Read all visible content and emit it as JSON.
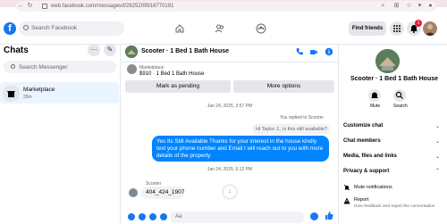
{
  "browser": {
    "url": "web.facebook.com/messages/t/28252099167701​91"
  },
  "header": {
    "logo_letter": "f",
    "search_placeholder": "Search Facebook",
    "find_friends_label": "Find friends",
    "notification_count": "1"
  },
  "left": {
    "title": "Chats",
    "search_placeholder": "Search Messenger",
    "chats": [
      {
        "title": "Marketplace",
        "subtitle": "29m"
      }
    ]
  },
  "conversation": {
    "title": "Scooter · 1 Bed 1 Bath House",
    "marketplace_label": "Marketplace",
    "listing": "$910 · 1 Bed 1 Bath House",
    "mark_pending_label": "Mark as pending",
    "more_options_label": "More options",
    "timestamp1": "Jan 24, 2025, 3:57 PM",
    "replied_label": "You replied to Scooter",
    "quoted_text": "Hi Taylor J., is this still available?",
    "outgoing_text": "Yes Its Still Available Thanks for your interest in the house kindly text your phone number and Email I will reach out to you with more details of the property",
    "timestamp2": "Jan 24, 2025, 6:12 PM",
    "sender_name": "Scooter",
    "incoming_text": "404_424_1907",
    "composer_placeholder": "Aa"
  },
  "details": {
    "title": "Scooter · 1 Bed 1 Bath House",
    "mute_label": "Mute",
    "search_label": "Search",
    "items": [
      "Customize chat",
      "Chat members",
      "Media, files and links",
      "Privacy & support"
    ],
    "mute_notifications_label": "Mute notifications",
    "report_label": "Report",
    "report_sub": "Give feedback and report the conversation"
  },
  "colors": {
    "brand_blue": "#1877f2",
    "bubble_blue": "#0084ff",
    "selected_bg": "#ebf5ff"
  }
}
